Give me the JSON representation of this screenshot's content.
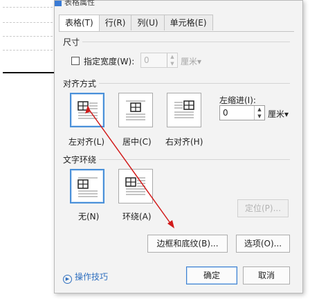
{
  "dialog": {
    "title": "表格属性",
    "tabs": [
      {
        "label": "表格(T)",
        "active": true
      },
      {
        "label": "行(R)",
        "active": false
      },
      {
        "label": "列(U)",
        "active": false
      },
      {
        "label": "单元格(E)",
        "active": false
      }
    ],
    "size": {
      "section": "尺寸",
      "specify_width_label": "指定宽度(W):",
      "specify_width_checked": false,
      "width_value": "0",
      "width_unit": "厘米"
    },
    "alignment": {
      "section": "对齐方式",
      "options": [
        {
          "label": "左对齐(L)",
          "selected": true
        },
        {
          "label": "居中(C)",
          "selected": false
        },
        {
          "label": "右对齐(H)",
          "selected": false
        }
      ],
      "indent_label": "左缩进(I):",
      "indent_value": "0",
      "indent_unit": "厘米"
    },
    "wrapping": {
      "section": "文字环绕",
      "options": [
        {
          "label": "无(N)",
          "selected": true
        },
        {
          "label": "环绕(A)",
          "selected": false
        }
      ],
      "position_button": "定位(P)..."
    },
    "borders_button": "边框和底纹(B)...",
    "options_button": "选项(O)...",
    "tips_link": "操作技巧",
    "ok_button": "确定",
    "cancel_button": "取消"
  },
  "colors": {
    "accent": "#4a90d9",
    "annotation_arrow": "#d11a1a",
    "link": "#2f6fbf"
  }
}
